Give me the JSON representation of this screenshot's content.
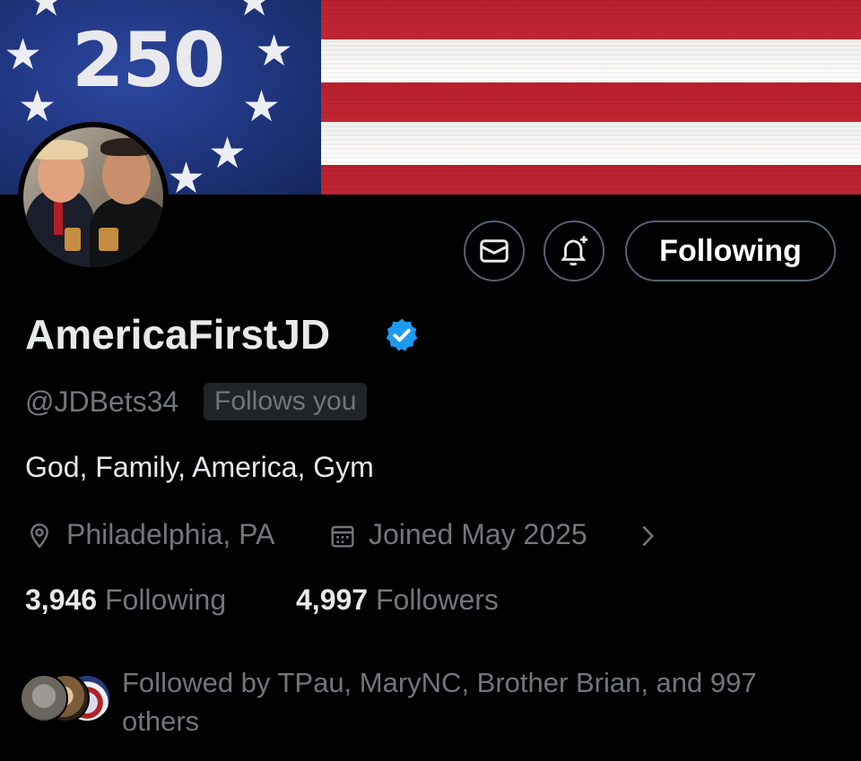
{
  "banner": {
    "text": "250"
  },
  "actions": {
    "message_icon": "envelope-icon",
    "notify_icon": "bell-plus-icon",
    "follow_label": "Following"
  },
  "profile": {
    "display_name": "AmericaFirstJD",
    "verified": true,
    "handle": "@JDBets34",
    "follows_you": "Follows you",
    "bio": "God, Family, America, Gym",
    "location": "Philadelphia, PA",
    "joined": "Joined May 2025"
  },
  "stats": {
    "following_count": "3,946",
    "following_label": "Following",
    "followers_count": "4,997",
    "followers_label": "Followers"
  },
  "followed_by": {
    "text": "Followed by TPau, MaryNC, Brother Brian, and 997 others"
  },
  "colors": {
    "background": "#000000",
    "muted": "#71767b",
    "verified": "#1d9bf0",
    "border": "#536471"
  }
}
